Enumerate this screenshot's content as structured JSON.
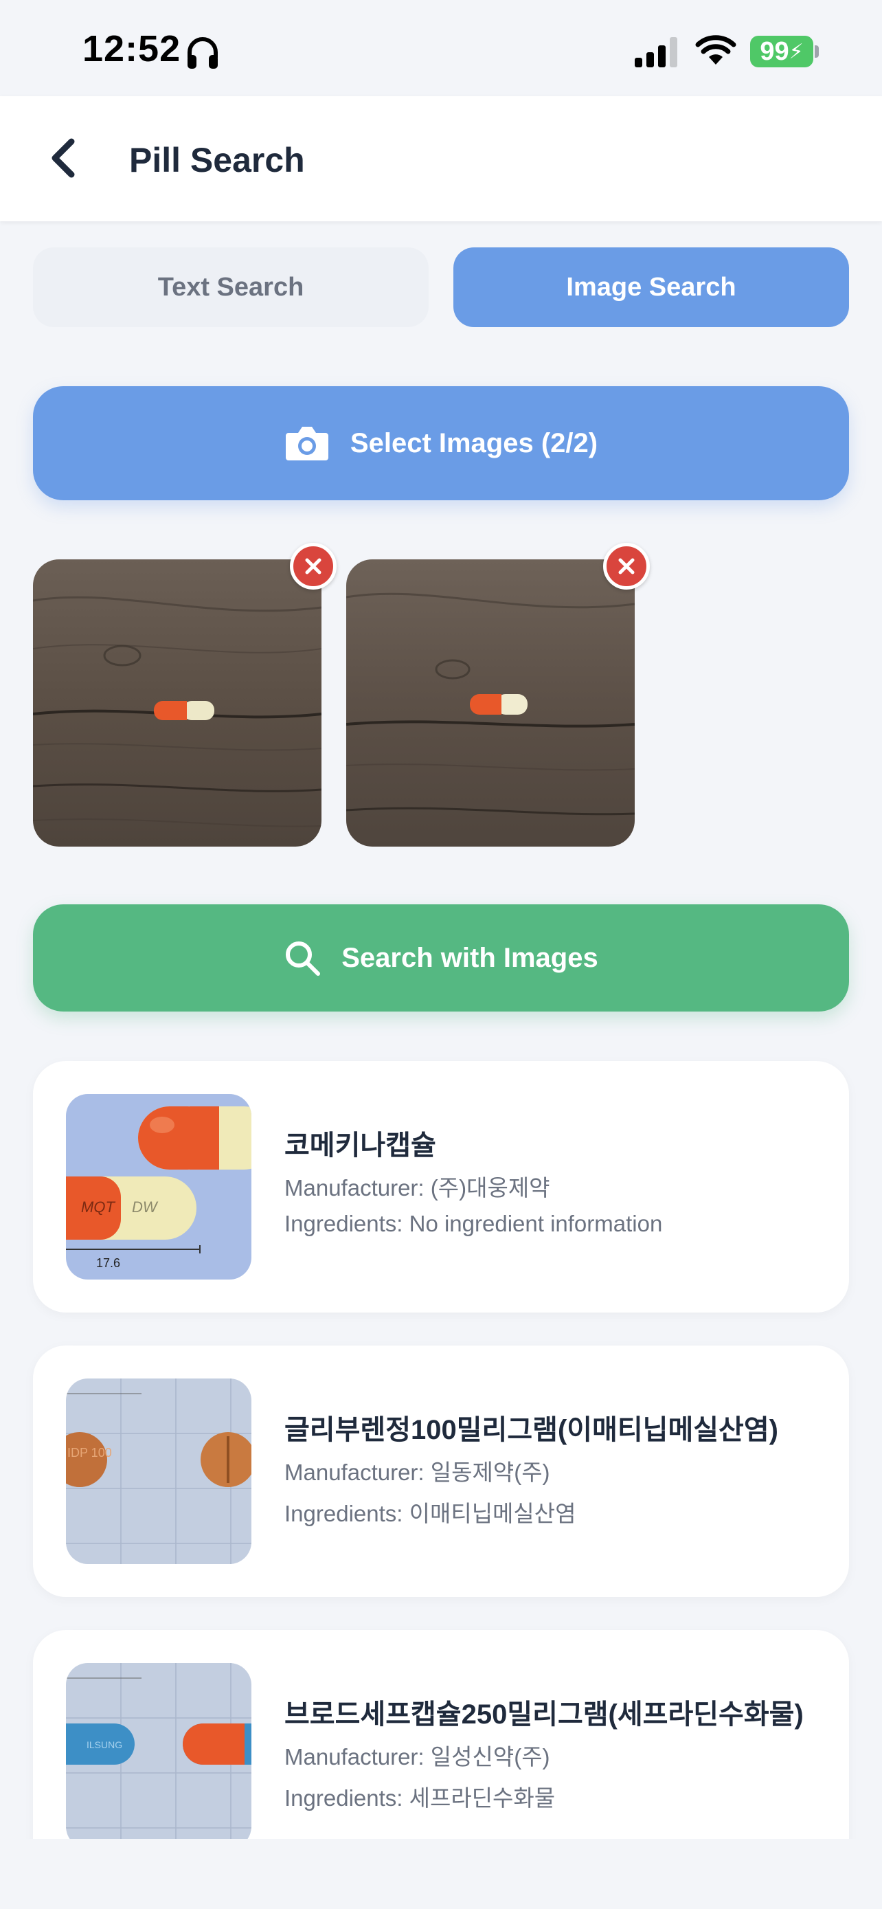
{
  "status_bar": {
    "time": "12:52",
    "battery": "99",
    "icons": [
      "headphone-icon",
      "signal-icon",
      "wifi-icon",
      "battery-icon"
    ]
  },
  "header": {
    "title": "Pill Search",
    "back_icon": "chevron-left-icon"
  },
  "tabs": [
    {
      "label": "Text Search",
      "active": false
    },
    {
      "label": "Image Search",
      "active": true
    }
  ],
  "select_button": {
    "label": "Select Images (2/2)",
    "icon": "camera-icon"
  },
  "selected_images": [
    {
      "remove_icon": "close-icon"
    },
    {
      "remove_icon": "close-icon"
    }
  ],
  "search_button": {
    "label": "Search with Images",
    "icon": "search-icon"
  },
  "results": [
    {
      "name": "코메키나캡슐",
      "manufacturer": "Manufacturer: (주)대웅제약",
      "ingredients": "Ingredients: No ingredient information",
      "image_text": {
        "imprint_left": "MQT",
        "imprint_right": "DW",
        "scale": "17.6"
      }
    },
    {
      "name": "글리부렌정100밀리그램(이매티닙메실산염)",
      "manufacturer": "Manufacturer: 일동제약(주)",
      "ingredients": "Ingredients: 이매티닙메실산염",
      "image_text": {
        "imprint": "IDP 100"
      }
    },
    {
      "name": "브로드세프캡슐250밀리그램(세프라딘수화물)",
      "manufacturer": "Manufacturer: 일성신약(주)",
      "ingredients": "Ingredients: 세프라딘수화물",
      "image_text": {
        "imprint": "ILSUNG"
      }
    }
  ],
  "colors": {
    "accent_blue": "#6a9ce6",
    "accent_green": "#55b882",
    "remove_red": "#d9453d",
    "background": "#f3f5f9"
  }
}
